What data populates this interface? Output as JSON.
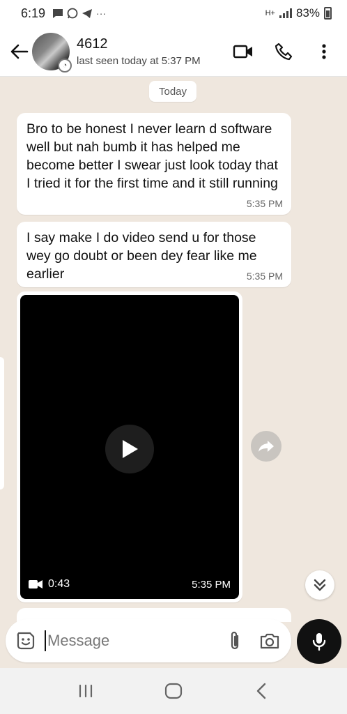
{
  "status_bar": {
    "time": "6:19",
    "notif_icons": [
      "message-icon",
      "whatsapp-icon",
      "telegram-icon",
      "more-dots"
    ],
    "more": "···",
    "network": "H+",
    "battery": "83%"
  },
  "header": {
    "contact_name": "4612",
    "last_seen": "last seen today at 5:37 PM"
  },
  "chat": {
    "date_chip": "Today",
    "messages": [
      {
        "text": "Bro to be honest I never learn d software well but nah bumb it has helped me become better I swear just look today that I tried it for the first time and it still running",
        "time": "5:35 PM"
      },
      {
        "text": "I say make I do video send u for those wey go doubt or been dey fear like me earlier",
        "time": "5:35 PM"
      }
    ],
    "video": {
      "duration": "0:43",
      "time": "5:35 PM"
    }
  },
  "composer": {
    "placeholder": "Message"
  },
  "colors": {
    "chat_background": "#efe7de",
    "bubble": "#ffffff",
    "mic_button": "#111111"
  }
}
